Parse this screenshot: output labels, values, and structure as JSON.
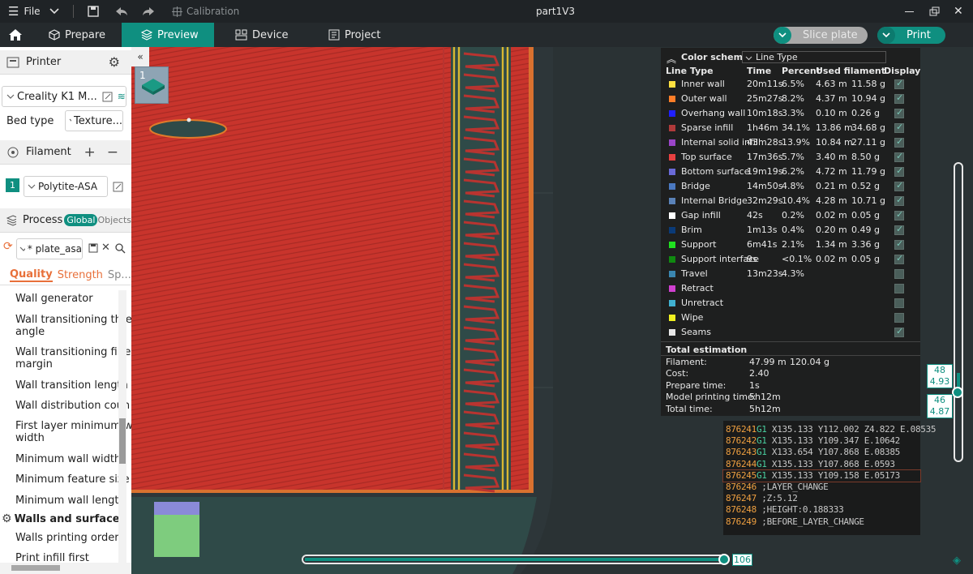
{
  "titlebar": {
    "file": "File",
    "calibration": "Calibration",
    "title": "part1V3"
  },
  "nav": {
    "prepare": "Prepare",
    "preview": "Preview",
    "device": "Device",
    "project": "Project",
    "slice": "Slice plate",
    "print": "Print"
  },
  "sidebar": {
    "printer_label": "Printer",
    "printer_name": "Creality K1 M...",
    "bed_type_label": "Bed type",
    "bed_type_value": "Texture...",
    "filament_label": "Filament",
    "filament_index": "1",
    "filament_name": "Polytite-ASA",
    "process_label": "Process",
    "global_label": "Global",
    "objects_label": "Objects",
    "process_preset": "* plate_asa",
    "tabs": [
      "Quality",
      "Strength",
      "Sp..."
    ],
    "items": [
      "Wall generator",
      "Wall transitioning thre",
      "angle",
      "Wall transitioning filte",
      "margin",
      "Wall transition length",
      "Wall distribution coun",
      "First layer minimum w",
      "width",
      "Minimum wall width",
      "Minimum feature size",
      "Minimum wall length"
    ],
    "section": "Walls and surfaces",
    "items2": [
      "Walls printing order",
      "Print infill first"
    ]
  },
  "legend": {
    "title": "Color scheme",
    "scheme": "Line Type",
    "headers": [
      "Line Type",
      "Time",
      "Percent",
      "Used filament",
      "Display"
    ],
    "rows": [
      {
        "name": "Inner wall",
        "time": "20m11s",
        "pct": "6.5%",
        "m": "4.63 m",
        "g": "11.58 g",
        "color": "#ffe040",
        "on": true
      },
      {
        "name": "Outer wall",
        "time": "25m27s",
        "pct": "8.2%",
        "m": "4.37 m",
        "g": "10.94 g",
        "color": "#ff7e28",
        "on": true
      },
      {
        "name": "Overhang wall",
        "time": "10m18s",
        "pct": "3.3%",
        "m": "0.10 m",
        "g": "0.26 g",
        "color": "#2020ff",
        "on": true
      },
      {
        "name": "Sparse infill",
        "time": "1h46m",
        "pct": "34.1%",
        "m": "13.86 m",
        "g": "34.68 g",
        "color": "#b03a3a",
        "on": true
      },
      {
        "name": "Internal solid infill",
        "time": "43m28s",
        "pct": "13.9%",
        "m": "10.84 m",
        "g": "27.11 g",
        "color": "#9b45c8",
        "on": true
      },
      {
        "name": "Top surface",
        "time": "17m36s",
        "pct": "5.7%",
        "m": "3.40 m",
        "g": "8.50 g",
        "color": "#e84040",
        "on": true
      },
      {
        "name": "Bottom surface",
        "time": "19m19s",
        "pct": "6.2%",
        "m": "4.72 m",
        "g": "11.79 g",
        "color": "#6a6ad8",
        "on": true
      },
      {
        "name": "Bridge",
        "time": "14m50s",
        "pct": "4.8%",
        "m": "0.21 m",
        "g": "0.52 g",
        "color": "#4a78c0",
        "on": true
      },
      {
        "name": "Internal Bridge",
        "time": "32m29s",
        "pct": "10.4%",
        "m": "4.28 m",
        "g": "10.71 g",
        "color": "#5a82b8",
        "on": true
      },
      {
        "name": "Gap infill",
        "time": "42s",
        "pct": "0.2%",
        "m": "0.02 m",
        "g": "0.05 g",
        "color": "#ffffff",
        "on": true
      },
      {
        "name": "Brim",
        "time": "1m13s",
        "pct": "0.4%",
        "m": "0.20 m",
        "g": "0.49 g",
        "color": "#0a3a78",
        "on": true
      },
      {
        "name": "Support",
        "time": "6m41s",
        "pct": "2.1%",
        "m": "1.34 m",
        "g": "3.36 g",
        "color": "#20e020",
        "on": true
      },
      {
        "name": "Support interface",
        "time": "9s",
        "pct": "<0.1%",
        "m": "0.02 m",
        "g": "0.05 g",
        "color": "#108a10",
        "on": true
      },
      {
        "name": "Travel",
        "time": "13m23s",
        "pct": "4.3%",
        "m": "",
        "g": "",
        "color": "#3a86b0",
        "on": false
      },
      {
        "name": "Retract",
        "time": "",
        "pct": "",
        "m": "",
        "g": "",
        "color": "#d040d0",
        "on": false
      },
      {
        "name": "Unretract",
        "time": "",
        "pct": "",
        "m": "",
        "g": "",
        "color": "#40b0d0",
        "on": false
      },
      {
        "name": "Wipe",
        "time": "",
        "pct": "",
        "m": "",
        "g": "",
        "color": "#f0f020",
        "on": false
      },
      {
        "name": "Seams",
        "time": "",
        "pct": "",
        "m": "",
        "g": "",
        "color": "#e8e8e8",
        "on": true
      }
    ],
    "total_title": "Total estimation",
    "totals": [
      {
        "label": "Filament:",
        "value": "47.99 m",
        "value2": "120.04 g"
      },
      {
        "label": "Cost:",
        "value": "2.40",
        "value2": ""
      },
      {
        "label": "Prepare time:",
        "value": "1s",
        "value2": ""
      },
      {
        "label": "Model printing time:",
        "value": "5h12m",
        "value2": ""
      },
      {
        "label": "Total time:",
        "value": "5h12m",
        "value2": ""
      }
    ]
  },
  "gcode": [
    {
      "n": "876241",
      "c": "G1",
      "t": " X135.133 Y112.002 Z4.822 E.08535"
    },
    {
      "n": "876242",
      "c": "G1",
      "t": " X135.133 Y109.347 E.10642"
    },
    {
      "n": "876243",
      "c": "G1",
      "t": " X133.654 Y107.868 E.08385"
    },
    {
      "n": "876244",
      "c": "G1",
      "t": " X135.133 Y107.868 E.0593"
    },
    {
      "n": "876245",
      "c": "G1",
      "t": " X135.133 Y109.158 E.05173"
    },
    {
      "n": "876246",
      "c": "",
      "t": " ;LAYER_CHANGE"
    },
    {
      "n": "876247",
      "c": "",
      "t": " ;Z:5.12"
    },
    {
      "n": "876248",
      "c": "",
      "t": " ;HEIGHT:0.188333"
    },
    {
      "n": "876249",
      "c": "",
      "t": " ;BEFORE_LAYER_CHANGE"
    }
  ],
  "layer": {
    "top_num": "48",
    "top_h": "4.93",
    "cur_num": "46",
    "cur_h": "4.87",
    "move_value": "106"
  },
  "plate_number": "1",
  "colors": {
    "accent": "#0f8f80",
    "model": "#c8342c",
    "bed": "#2f4a48"
  }
}
